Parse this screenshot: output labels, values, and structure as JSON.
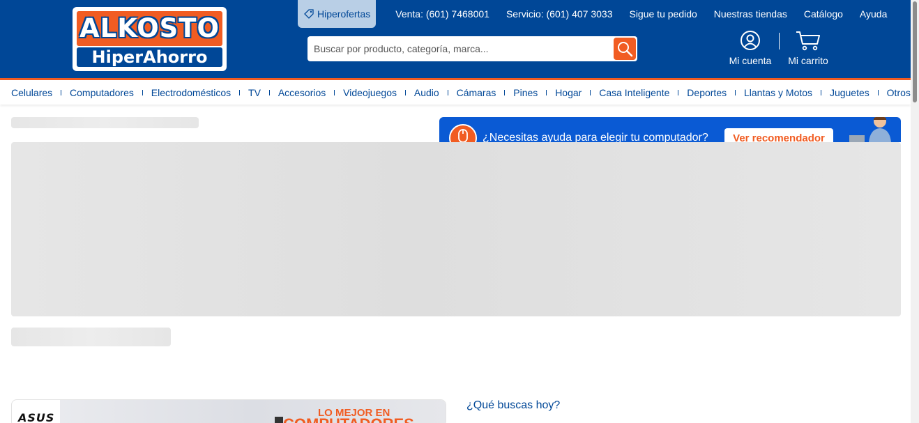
{
  "logo": {
    "line1": "ALKOSTO",
    "line2": "HiperAhorro"
  },
  "topnav": {
    "hiperofertas": "Hiperofertas",
    "links": [
      "Venta: (601) 7468001",
      "Servicio: (601) 407 3033",
      "Sigue tu pedido",
      "Nuestras tiendas",
      "Catálogo",
      "Ayuda"
    ]
  },
  "search": {
    "placeholder": "Buscar por producto, categoría, marca..."
  },
  "account": {
    "label": "Mi cuenta"
  },
  "cart": {
    "label": "Mi carrito"
  },
  "categories": [
    "Celulares",
    "Computadores",
    "Electrodomésticos",
    "TV",
    "Accesorios",
    "Videojuegos",
    "Audio",
    "Cámaras",
    "Pines",
    "Hogar",
    "Casa Inteligente",
    "Deportes",
    "Llantas y Motos",
    "Juguetes",
    "Otros"
  ],
  "help_banner": {
    "text": "¿Necesitas ayuda para elegir tu computador?",
    "button": "Ver recomendador"
  },
  "promo": {
    "brand": "ASUS",
    "line1": "LO MEJOR EN",
    "line2": "COMPUTADORES"
  },
  "section": {
    "title": "¿Qué buscas hoy?"
  },
  "colors": {
    "brand_blue": "#004797",
    "brand_orange": "#f15c22",
    "help_blue": "#0a5ad4"
  }
}
